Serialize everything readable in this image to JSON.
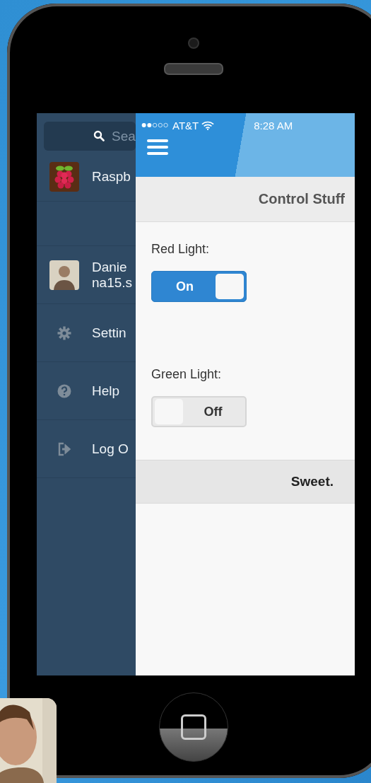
{
  "menu": {
    "search": {
      "placeholder": "Sea"
    },
    "items": [
      {
        "kind": "app",
        "label": "Raspb"
      },
      {
        "kind": "spacer"
      },
      {
        "kind": "user",
        "label": "Danie",
        "sublabel": "na15.s"
      },
      {
        "kind": "settings",
        "label": "Settin"
      },
      {
        "kind": "help",
        "label": "Help"
      },
      {
        "kind": "logout",
        "label": "Log O"
      }
    ]
  },
  "status_bar": {
    "carrier": "AT&T",
    "time": "8:28 AM"
  },
  "title": "Control Stuff",
  "toggles": [
    {
      "label": "Red Light:",
      "state_label": "On",
      "on": true
    },
    {
      "label": "Green Light:",
      "state_label": "Off",
      "on": false
    }
  ],
  "footer_button": "Sweet."
}
